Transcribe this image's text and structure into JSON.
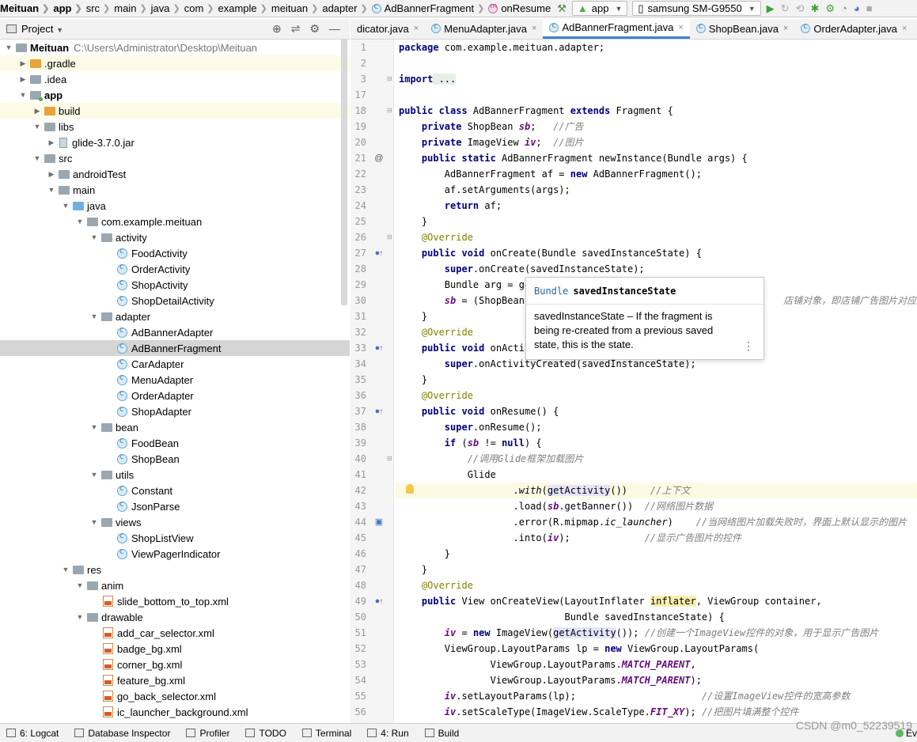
{
  "toolbar": {
    "crumbs": [
      "Meituan",
      "app",
      "src",
      "main",
      "java",
      "com",
      "example",
      "meituan",
      "adapter",
      "AdBannerFragment",
      "onResume"
    ],
    "run_config": "app",
    "device": "samsung SM-G9550"
  },
  "project_panel": {
    "title": "Project",
    "project_path": "C:\\Users\\Administrator\\Desktop\\Meituan",
    "items": [
      {
        "label": "Meituan"
      },
      {
        "label": ".gradle"
      },
      {
        "label": ".idea"
      },
      {
        "label": "app"
      },
      {
        "label": "build"
      },
      {
        "label": "libs"
      },
      {
        "label": "glide-3.7.0.jar"
      },
      {
        "label": "src"
      },
      {
        "label": "androidTest"
      },
      {
        "label": "main"
      },
      {
        "label": "java"
      },
      {
        "label": "com.example.meituan"
      },
      {
        "label": "activity"
      },
      {
        "label": "FoodActivity"
      },
      {
        "label": "OrderActivity"
      },
      {
        "label": "ShopActivity"
      },
      {
        "label": "ShopDetailActivity"
      },
      {
        "label": "adapter"
      },
      {
        "label": "AdBannerAdapter"
      },
      {
        "label": "AdBannerFragment"
      },
      {
        "label": "CarAdapter"
      },
      {
        "label": "MenuAdapter"
      },
      {
        "label": "OrderAdapter"
      },
      {
        "label": "ShopAdapter"
      },
      {
        "label": "bean"
      },
      {
        "label": "FoodBean"
      },
      {
        "label": "ShopBean"
      },
      {
        "label": "utils"
      },
      {
        "label": "Constant"
      },
      {
        "label": "JsonParse"
      },
      {
        "label": "views"
      },
      {
        "label": "ShopListView"
      },
      {
        "label": "ViewPagerIndicator"
      },
      {
        "label": "res"
      },
      {
        "label": "anim"
      },
      {
        "label": "slide_bottom_to_top.xml"
      },
      {
        "label": "drawable"
      },
      {
        "label": "add_car_selector.xml"
      },
      {
        "label": "badge_bg.xml"
      },
      {
        "label": "corner_bg.xml"
      },
      {
        "label": "feature_bg.xml"
      },
      {
        "label": "go_back_selector.xml"
      },
      {
        "label": "ic_launcher_background.xml"
      }
    ]
  },
  "editor_tabs": [
    {
      "label": "dicator.java"
    },
    {
      "label": "MenuAdapter.java"
    },
    {
      "label": "AdBannerFragment.java",
      "active": true
    },
    {
      "label": "ShopBean.java"
    },
    {
      "label": "OrderAdapter.java"
    }
  ],
  "line_numbers": [
    "1",
    "2",
    "3",
    "17",
    "18",
    "19",
    "20",
    "21",
    "22",
    "23",
    "24",
    "25",
    "26",
    "27",
    "28",
    "29",
    "30",
    "31",
    "32",
    "33",
    "34",
    "35",
    "36",
    "37",
    "38",
    "39",
    "40",
    "41",
    "42",
    "43",
    "44",
    "45",
    "46",
    "47",
    "48",
    "49",
    "50",
    "51",
    "52",
    "53",
    "54",
    "55",
    "56"
  ],
  "code": {
    "l1": {
      "kw": "package",
      "rest": " com.example.meituan.adapter;"
    },
    "l3": {
      "kw": "import",
      "fold": " ..."
    },
    "l18": {
      "kw1": "public class",
      "name": " AdBannerFragment ",
      "kw2": "extends",
      "rest": " Fragment {"
    },
    "l19": {
      "indent": "    ",
      "kw": "private",
      "rest": " ShopBean ",
      "field": "sb",
      "semi": ";   ",
      "cm": "//广告"
    },
    "l20": {
      "indent": "    ",
      "kw": "private",
      "rest": " ImageView ",
      "field": "iv",
      "semi": ";  ",
      "cm": "//图片"
    },
    "l21": {
      "indent": "    ",
      "kw": "public static",
      "rest": " AdBannerFragment newInstance(Bundle args) {"
    },
    "l22": {
      "indent": "        ",
      "pre": "AdBannerFragment af = ",
      "kw": "new",
      "rest": " AdBannerFragment();"
    },
    "l23": {
      "text": "        af.setArguments(args);"
    },
    "l24": {
      "indent": "        ",
      "kw": "return",
      "rest": " af;"
    },
    "l25": {
      "text": "    }"
    },
    "l26": {
      "indent": "    ",
      "an": "@Override"
    },
    "l27": {
      "indent": "    ",
      "kw": "public void",
      "rest": " onCreate(Bundle savedInstanceState) {"
    },
    "l28": {
      "indent": "        ",
      "kw": "super",
      "rest": ".onCreate(savedInstanceState);"
    },
    "l29": {
      "text": "        Bundle arg = ge"
    },
    "l30": {
      "indent": "        ",
      "pre": "sb",
      "rest": " = (ShopBean)",
      "cm": "店铺对象，即店铺广告图片对应的"
    },
    "l31": {
      "text": "    }"
    },
    "l32": {
      "indent": "    ",
      "an": "@Override"
    },
    "l33": {
      "indent": "    ",
      "kw": "public void",
      "rest": " onActiv"
    },
    "l34": {
      "indent": "        ",
      "kw": "super",
      "rest": ".onActivityCreated(savedInstanceState);"
    },
    "l35": {
      "text": "    }"
    },
    "l36": {
      "indent": "    ",
      "an": "@Override"
    },
    "l37": {
      "indent": "    ",
      "kw": "public void",
      "rest": " onResume() {"
    },
    "l38": {
      "indent": "        ",
      "kw": "super",
      "rest": ".onResume();"
    },
    "l39": {
      "indent": "        ",
      "kw": "if",
      "pre": " (",
      "field": "sb",
      "mid": " != ",
      "kw2": "null",
      "rest": ") {"
    },
    "l40": {
      "indent": "            ",
      "cm": "//调用Glide框架加载图片"
    },
    "l41": {
      "text": "            Glide"
    },
    "l42": {
      "indent": "                    .",
      "it": "with",
      "pre": "(",
      "hl": "getActivity",
      "rest": "())    ",
      "cm": "//上下文"
    },
    "l43": {
      "indent": "                    ",
      "pre": ".load(",
      "field": "sb",
      "rest": ".getBanner())  ",
      "cm": "//网络图片数据"
    },
    "l44": {
      "indent": "                    ",
      "pre": ".error(R.mipmap.",
      "it": "ic_launcher",
      "rest": ")    ",
      "cm": "//当网络图片加载失败时，界面上默认显示的图片"
    },
    "l45": {
      "indent": "                    ",
      "pre": ".into(",
      "field": "iv",
      "rest": ");             ",
      "cm": "//显示广告图片的控件"
    },
    "l46": {
      "text": "        }"
    },
    "l47": {
      "text": "    }"
    },
    "l48": {
      "indent": "    ",
      "an": "@Override"
    },
    "l49": {
      "indent": "    ",
      "kw": "public",
      "pre": " View onCreateView(LayoutInflater ",
      "hl": "inflater",
      "rest": ", ViewGroup container,"
    },
    "l50": {
      "text": "                             Bundle savedInstanceState) {"
    },
    "l51": {
      "indent": "        ",
      "field": "iv",
      "pre": " = ",
      "kw": "new",
      "mid": " ImageView(",
      "hl": "getActivity",
      "rest": "()); ",
      "cm": "//创建一个ImageView控件的对象，用于显示广告图片"
    },
    "l52": {
      "indent": "        ",
      "pre": "ViewGroup.LayoutParams lp = ",
      "kw": "new",
      "rest": " ViewGroup.LayoutParams("
    },
    "l53": {
      "indent": "                ",
      "pre": "ViewGroup.LayoutParams.",
      "fld": "MATCH_PARENT",
      "rest": ","
    },
    "l54": {
      "indent": "                ",
      "pre": "ViewGroup.LayoutParams.",
      "fld": "MATCH_PARENT",
      "rest": ");"
    },
    "l55": {
      "indent": "        ",
      "field": "iv",
      "rest": ".setLayoutParams(lp);                      ",
      "cm": "//设置ImageView控件的宽高参数"
    },
    "l56": {
      "indent": "        ",
      "field": "iv",
      "pre": ".setScaleType(ImageView.ScaleType.",
      "fld": "FIT_XY",
      "rest": "); ",
      "cm": "//把图片填满整个控件"
    }
  },
  "popup": {
    "type": "Bundle",
    "name": "savedInstanceState",
    "body": "savedInstanceState – If the fragment is being re-created from a previous saved state, this is the state."
  },
  "status_bar": {
    "items": [
      {
        "label": "6: Logcat"
      },
      {
        "label": "Database Inspector"
      },
      {
        "label": "Profiler"
      },
      {
        "label": "TODO"
      },
      {
        "label": "Terminal"
      },
      {
        "label": "4: Run"
      },
      {
        "label": "Build"
      }
    ],
    "watermark": "CSDN @m0_52239519",
    "trailing": "Ev"
  }
}
